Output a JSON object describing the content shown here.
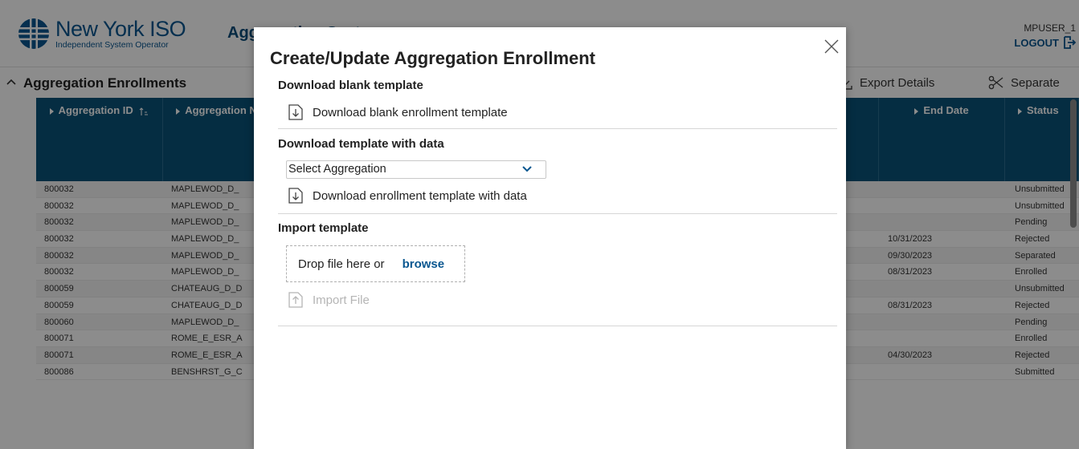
{
  "header": {
    "logo_title": "New York ISO",
    "logo_subtitle": "Independent System Operator",
    "app_title": "Aggregation System",
    "username": "MPUSER_1",
    "logout_label": "LOGOUT"
  },
  "section": {
    "title": "Aggregation Enrollments",
    "export_label": "Export Details",
    "separate_label": "Separate"
  },
  "grid": {
    "columns": [
      "Aggregation ID",
      "Aggregation Name",
      "End Date",
      "Status"
    ],
    "rows": [
      {
        "id": "800032",
        "name": "MAPLEWOD_D_",
        "end": "",
        "status": "Unsubmitted"
      },
      {
        "id": "800032",
        "name": "MAPLEWOD_D_",
        "end": "",
        "status": "Unsubmitted"
      },
      {
        "id": "800032",
        "name": "MAPLEWOD_D_",
        "end": "",
        "status": "Pending"
      },
      {
        "id": "800032",
        "name": "MAPLEWOD_D_",
        "end": "10/31/2023",
        "status": "Rejected"
      },
      {
        "id": "800032",
        "name": "MAPLEWOD_D_",
        "end": "09/30/2023",
        "status": "Separated"
      },
      {
        "id": "800032",
        "name": "MAPLEWOD_D_",
        "end": "08/31/2023",
        "status": "Enrolled"
      },
      {
        "id": "800059",
        "name": "CHATEAUG_D_D",
        "end": "",
        "status": "Unsubmitted"
      },
      {
        "id": "800059",
        "name": "CHATEAUG_D_D",
        "end": "08/31/2023",
        "status": "Rejected"
      },
      {
        "id": "800060",
        "name": "MAPLEWOD_D_",
        "end": "",
        "status": "Pending"
      },
      {
        "id": "800071",
        "name": "ROME_E_ESR_A",
        "end": "",
        "status": "Enrolled"
      },
      {
        "id": "800071",
        "name": "ROME_E_ESR_A",
        "end": "04/30/2023",
        "status": "Rejected"
      },
      {
        "id": "800086",
        "name": "BENSHRST_G_C",
        "end": "",
        "status": "Submitted"
      }
    ]
  },
  "modal": {
    "title": "Create/Update Aggregation Enrollment",
    "blank_section": "Download blank template",
    "blank_link": "Download blank enrollment template",
    "data_section": "Download template with data",
    "select_value": "Select Aggregation",
    "data_link": "Download enrollment template with data",
    "import_section": "Import template",
    "drop_text": "Drop file here or",
    "browse_label": "browse",
    "import_label": "Import File"
  },
  "colors": {
    "brand": "#0a5790",
    "grid_header": "#0a5278",
    "overlay": "rgba(0,0,0,0.45)"
  }
}
